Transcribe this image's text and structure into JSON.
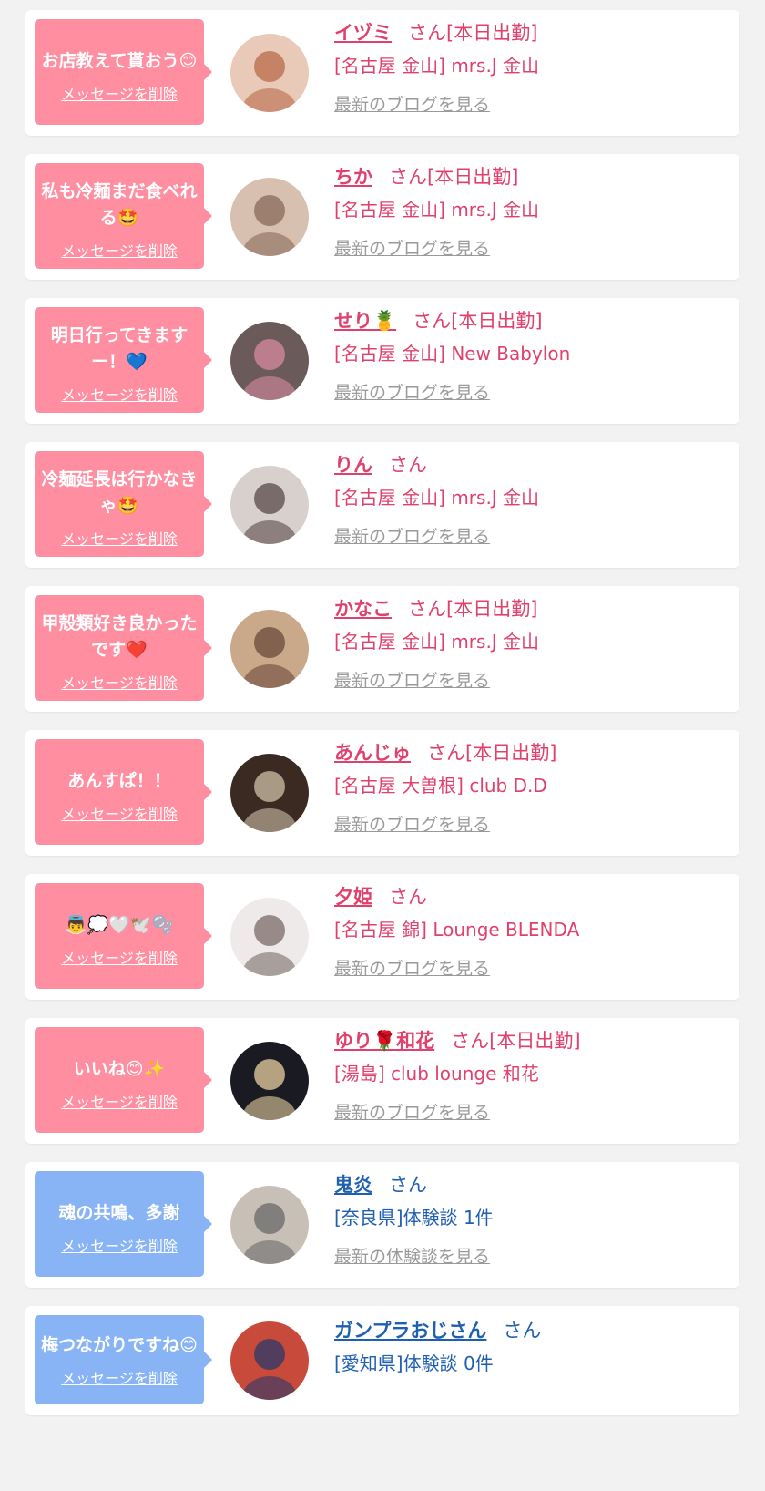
{
  "colors": {
    "page_bg": "#f2f2f2",
    "card_bg": "#ffffff",
    "cast_bubble": "#fe8ea0",
    "user_bubble": "#88b4f5",
    "cast_text": "#e0416c",
    "user_text": "#1f5fb0",
    "link_gray": "#9a9a9a"
  },
  "delete_label": "メッセージを削除",
  "san_label": "さん",
  "items": [
    {
      "type": "cast",
      "message": "お店教えて貰おう😊",
      "name": "イヅミ",
      "status": "[本日出勤]",
      "shop": "[名古屋 金山] mrs.J 金山",
      "link": "最新のブログを見る",
      "avatar_icon": "profile-photo"
    },
    {
      "type": "cast",
      "message": "私も冷麺まだ食べれる🤩",
      "name": "ちか",
      "status": "[本日出勤]",
      "shop": "[名古屋 金山] mrs.J 金山",
      "link": "最新のブログを見る",
      "avatar_icon": "profile-photo"
    },
    {
      "type": "cast",
      "message": "明日行ってきますー！💙",
      "name": "せり🍍",
      "status": "[本日出勤]",
      "shop": "[名古屋 金山] New Babylon",
      "link": "最新のブログを見る",
      "avatar_icon": "profile-photo"
    },
    {
      "type": "cast",
      "message": "冷麺延長は行かなきゃ🤩",
      "name": "りん",
      "status": "",
      "shop": "[名古屋 金山] mrs.J 金山",
      "link": "最新のブログを見る",
      "avatar_icon": "profile-photo"
    },
    {
      "type": "cast",
      "message": "甲殻類好き良かったです❤️",
      "name": "かなこ",
      "status": "[本日出勤]",
      "shop": "[名古屋 金山] mrs.J 金山",
      "link": "最新のブログを見る",
      "avatar_icon": "profile-photo"
    },
    {
      "type": "cast",
      "message": "あんすぱ！！",
      "name": "あんじゅ",
      "status": "[本日出勤]",
      "shop": "[名古屋 大曽根] club D.D",
      "link": "最新のブログを見る",
      "avatar_icon": "profile-photo"
    },
    {
      "type": "cast",
      "message": "👼💭🤍🕊️🫧",
      "name": "夕姫",
      "status": "",
      "shop": "[名古屋 錦] Lounge BLENDA",
      "link": "最新のブログを見る",
      "avatar_icon": "profile-photo"
    },
    {
      "type": "cast",
      "message": "いいね😊✨",
      "name": "ゆり🌹和花",
      "status": "[本日出勤]",
      "shop": "[湯島] club lounge 和花",
      "link": "最新のブログを見る",
      "avatar_icon": "profile-photo"
    },
    {
      "type": "user",
      "message": "魂の共鳴、多謝",
      "name": "鬼炎",
      "status": "",
      "shop": "[奈良県]体験談 1件",
      "link": "最新の体験談を見る",
      "avatar_icon": "profile-photo"
    },
    {
      "type": "user",
      "message": "梅つながりですね😊",
      "name": "ガンプラおじさん",
      "status": "",
      "shop": "[愛知県]体験談 0件",
      "link": "",
      "avatar_icon": "profile-photo"
    }
  ]
}
